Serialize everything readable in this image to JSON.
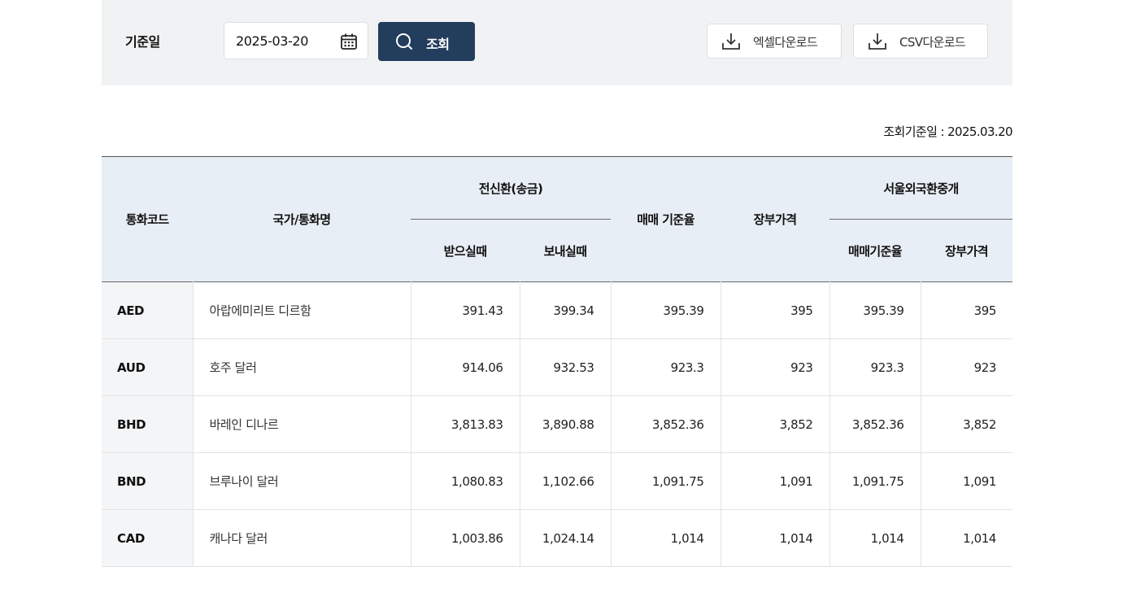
{
  "filter": {
    "label": "기준일",
    "date_value": "2025-03-20",
    "search_label": "조회",
    "excel_label": "엑셀다운로드",
    "csv_label": "CSV다운로드"
  },
  "query_date_text": "조회기준일 : 2025.03.20",
  "table": {
    "headers": {
      "code": "통화코드",
      "name": "국가/통화명",
      "tt_group": "전신환(송금)",
      "tt_receive": "받으실때",
      "tt_send": "보내실때",
      "base_rate": "매매 기준율",
      "book_price": "장부가격",
      "seoul_group": "서울외국환중개",
      "seoul_base": "매매기준율",
      "seoul_book": "장부가격"
    },
    "rows": [
      {
        "code": "AED",
        "name": "아랍에미리트 디르함",
        "receive": "391.43",
        "send": "399.34",
        "base": "395.39",
        "book": "395",
        "seoul_base": "395.39",
        "seoul_book": "395"
      },
      {
        "code": "AUD",
        "name": "호주 달러",
        "receive": "914.06",
        "send": "932.53",
        "base": "923.3",
        "book": "923",
        "seoul_base": "923.3",
        "seoul_book": "923"
      },
      {
        "code": "BHD",
        "name": "바레인 디나르",
        "receive": "3,813.83",
        "send": "3,890.88",
        "base": "3,852.36",
        "book": "3,852",
        "seoul_base": "3,852.36",
        "seoul_book": "3,852"
      },
      {
        "code": "BND",
        "name": "브루나이 달러",
        "receive": "1,080.83",
        "send": "1,102.66",
        "base": "1,091.75",
        "book": "1,091",
        "seoul_base": "1,091.75",
        "seoul_book": "1,091"
      },
      {
        "code": "CAD",
        "name": "캐나다 달러",
        "receive": "1,003.86",
        "send": "1,024.14",
        "base": "1,014",
        "book": "1,014",
        "seoul_base": "1,014",
        "seoul_book": "1,014"
      }
    ]
  }
}
